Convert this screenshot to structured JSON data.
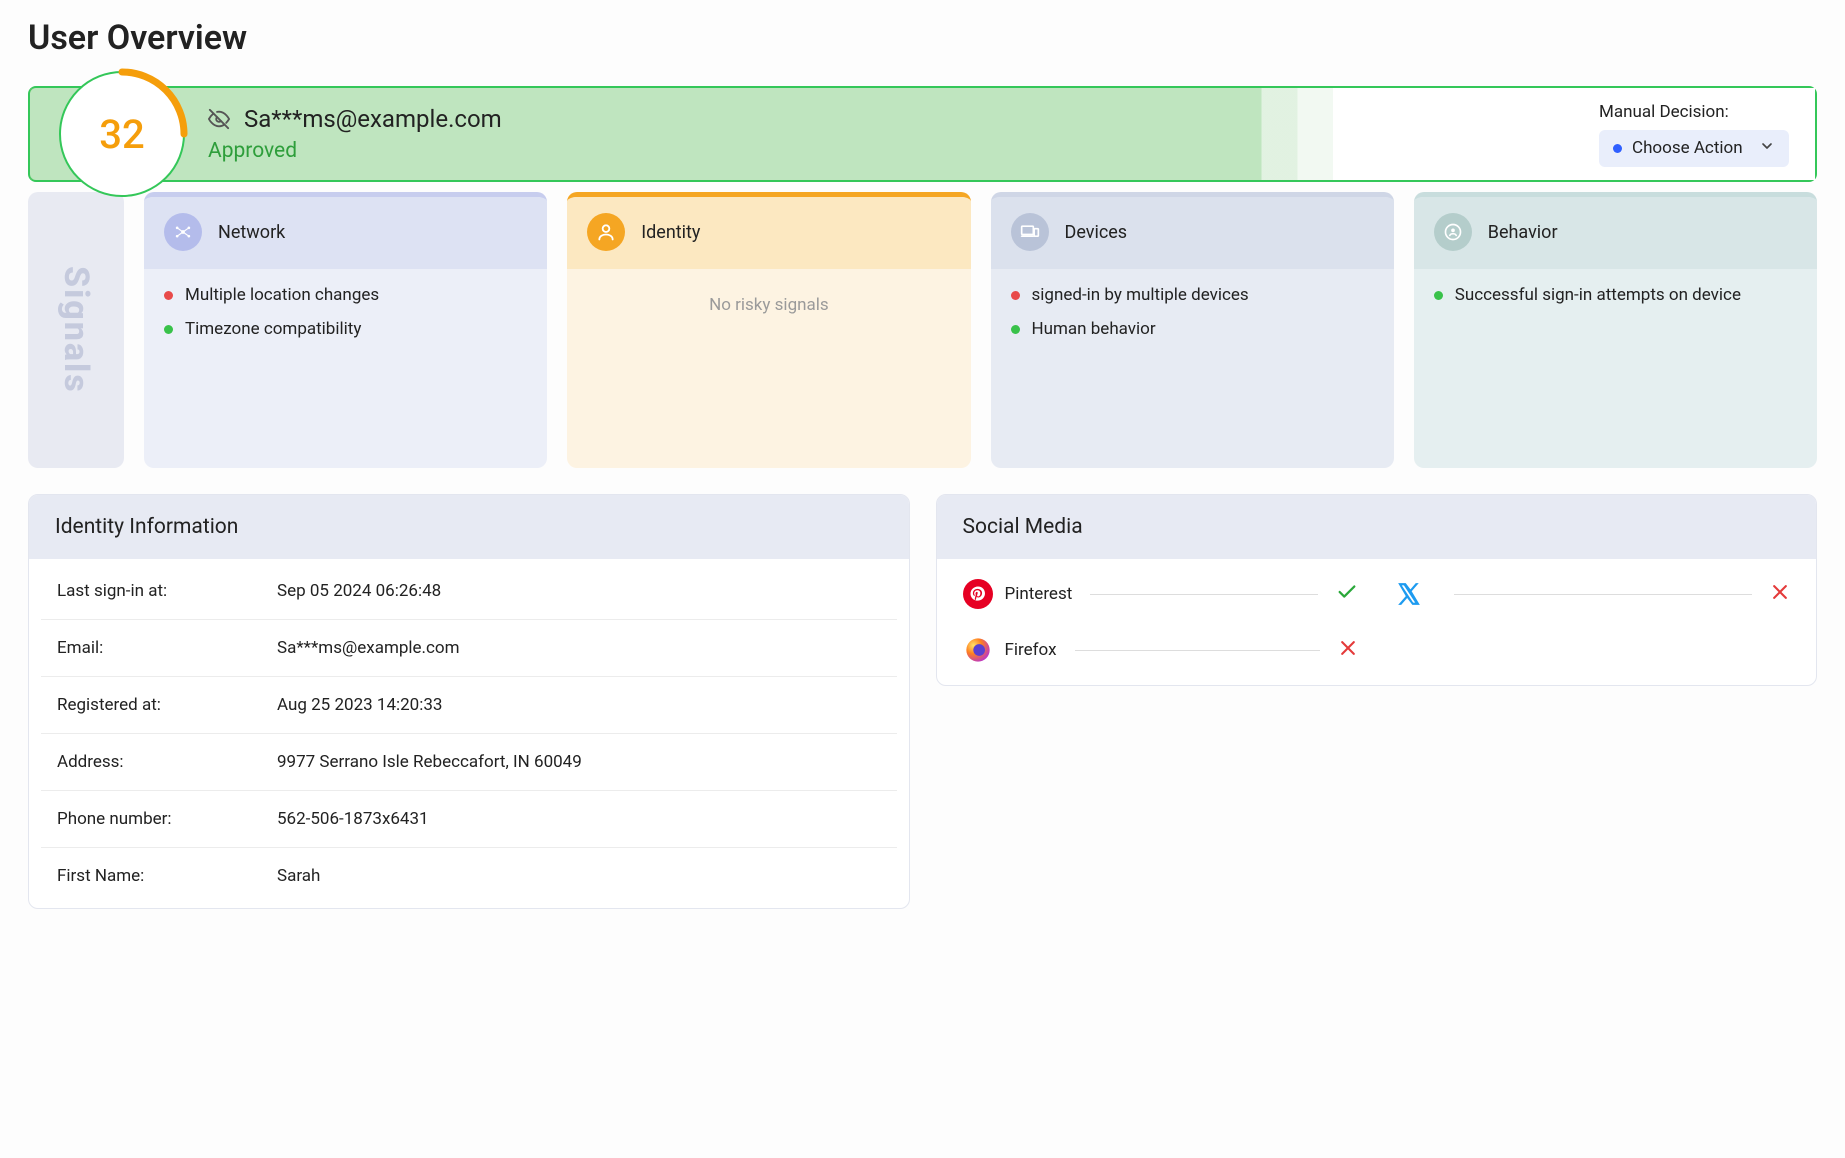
{
  "page_title": "User Overview",
  "banner": {
    "score": "32",
    "email": "Sa***ms@example.com",
    "status": "Approved",
    "manual_decision_label": "Manual Decision:",
    "choose_action_label": "Choose Action"
  },
  "signals": {
    "side_label": "Signals",
    "cards": {
      "network": {
        "title": "Network",
        "items": [
          {
            "color": "red",
            "text": "Multiple location changes"
          },
          {
            "color": "green",
            "text": "Timezone compatibility"
          }
        ]
      },
      "identity": {
        "title": "Identity",
        "no_risky_text": "No risky signals"
      },
      "devices": {
        "title": "Devices",
        "items": [
          {
            "color": "red",
            "text": "signed-in by multiple devices"
          },
          {
            "color": "green",
            "text": "Human behavior"
          }
        ]
      },
      "behavior": {
        "title": "Behavior",
        "items": [
          {
            "color": "green",
            "text": "Successful sign-in attempts on device"
          }
        ]
      }
    }
  },
  "identity_panel": {
    "title": "Identity Information",
    "rows": [
      {
        "label": "Last sign-in at:",
        "value": "Sep 05 2024 06:26:48"
      },
      {
        "label": "Email:",
        "value": "Sa***ms@example.com"
      },
      {
        "label": "Registered at:",
        "value": "Aug 25 2023 14:20:33"
      },
      {
        "label": "Address:",
        "value": "9977 Serrano Isle Rebeccafort, IN 60049"
      },
      {
        "label": "Phone number:",
        "value": "562-506-1873x6431"
      },
      {
        "label": "First Name:",
        "value": "Sarah"
      }
    ]
  },
  "social_panel": {
    "title": "Social Media",
    "items": [
      {
        "name": "Pinterest",
        "status": "check",
        "icon": "pinterest"
      },
      {
        "name": "",
        "status": "cross",
        "icon": "x-twitter"
      },
      {
        "name": "Firefox",
        "status": "cross",
        "icon": "firefox"
      }
    ]
  }
}
